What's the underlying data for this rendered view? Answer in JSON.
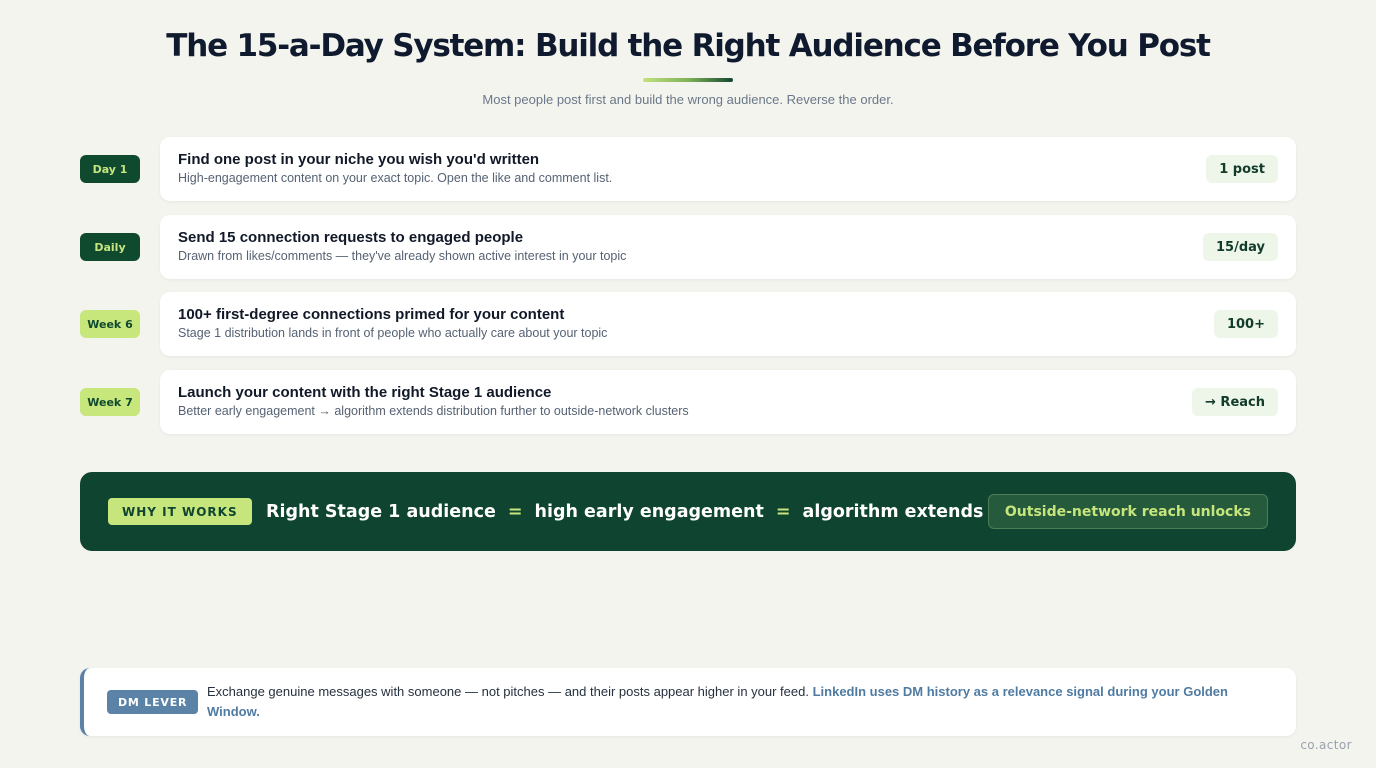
{
  "header": {
    "title": "The 15-a-Day System: Build the Right Audience Before You Post",
    "subtitle": "Most people post first and build the wrong audience. Reverse the order."
  },
  "steps": [
    {
      "tag": "Day 1",
      "tag_style": "dark",
      "title": "Find one post in your niche you wish you'd written",
      "desc": "High-engagement content on your exact topic. Open the like and comment list.",
      "metric": "1 post"
    },
    {
      "tag": "Daily",
      "tag_style": "dark",
      "title": "Send 15 connection requests to engaged people",
      "desc": "Drawn from likes/comments — they've already shown active interest in your topic",
      "metric": "15/day"
    },
    {
      "tag": "Week 6",
      "tag_style": "light",
      "title": "100+ first-degree connections primed for your content",
      "desc": "Stage 1 distribution lands in front of people who actually care about your topic",
      "metric": "100+"
    },
    {
      "tag": "Week 7",
      "tag_style": "light",
      "title": "Launch your content with the right Stage 1 audience",
      "desc": "Better early engagement → algorithm extends distribution further to outside-network clusters",
      "metric": "→ Reach"
    }
  ],
  "why": {
    "badge": "WHY IT WORKS",
    "part1": "Right Stage 1 audience",
    "eq1": "=",
    "part2": "high early engagement",
    "eq2": "=",
    "part3": "algorithm extends",
    "result": "Outside-network reach unlocks"
  },
  "dm": {
    "badge": "DM LEVER",
    "text": "Exchange genuine messages with someone — not pitches — and their posts appear higher in your feed. ",
    "highlight": "LinkedIn uses DM history as a relevance signal during your Golden Window."
  },
  "brand": "co.actor",
  "colors": {
    "background": "#f4f4ef",
    "dark_green": "#0f4a2e",
    "lime": "#c6e57c",
    "steel_blue": "#5b83a8"
  }
}
